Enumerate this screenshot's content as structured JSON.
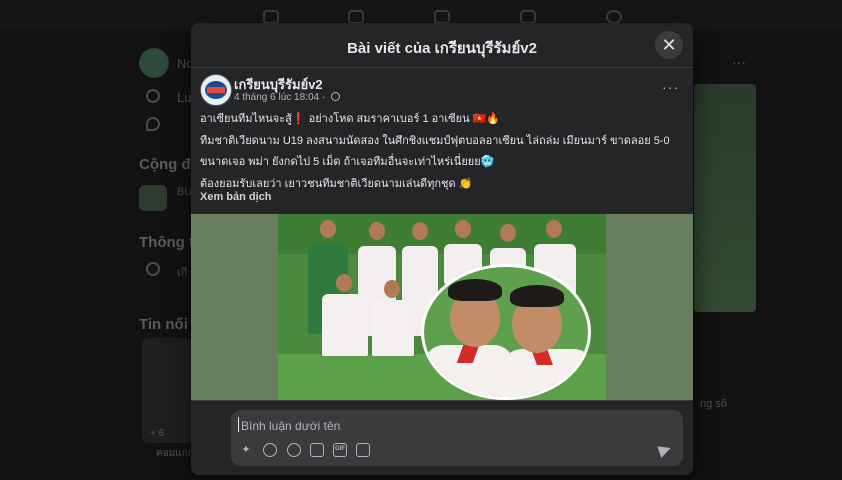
{
  "background": {
    "left_items": [
      "Lu",
      "No",
      "Cộng đồ",
      "BU",
      "Thông t",
      "เกี",
      "Tin nổi"
    ],
    "right_items": [
      "ng số"
    ],
    "counter": "+ 6",
    "bottom_caption": "คอมแกก"
  },
  "modal": {
    "title": "Bài viết của เกรียนบุรีรัมย์v2",
    "close_icon": "close-icon"
  },
  "post": {
    "author": "เกรียนบุรีรัมย์v2",
    "timestamp": "4 tháng 6 lúc 18:04",
    "more_label": "···",
    "lines": [
      "อาเซียนทีมไหนจะสู้❗ อย่างโหด สมราคาเบอร์ 1 อาเซียน 🇻🇳🔥",
      "ทีมชาติเวียดนาม U19 ลงสนามนัดสอง ในศึกชิงแชมป์ฟุตบอลอาเซียน ไล่ถล่ม เมียนมาร์ ขาดลอย 5-0",
      "ขนาดเจอ พม่า ยังกดไป 5 เม็ด ถ้าเจอทีมอื่นจะเท่าไหร่เนี่ยยย🥶",
      "ต้องยอมรับเลยว่า เยาวชนทีมชาติเวียดนามเล่นดีทุกชุด 👏"
    ],
    "see_translation": "Xem bản dịch"
  },
  "composer": {
    "placeholder": "Bình luận dưới tên",
    "tools": [
      "avatar-sticker-icon",
      "emoji-icon",
      "camera-icon",
      "gif-icon",
      "sticker-icon"
    ],
    "gif_label": "GIF"
  },
  "colors": {
    "modal_bg": "#242526",
    "text": "#e4e6eb",
    "secondary_text": "#b0b3b8",
    "input_bg": "#3a3b3c"
  }
}
